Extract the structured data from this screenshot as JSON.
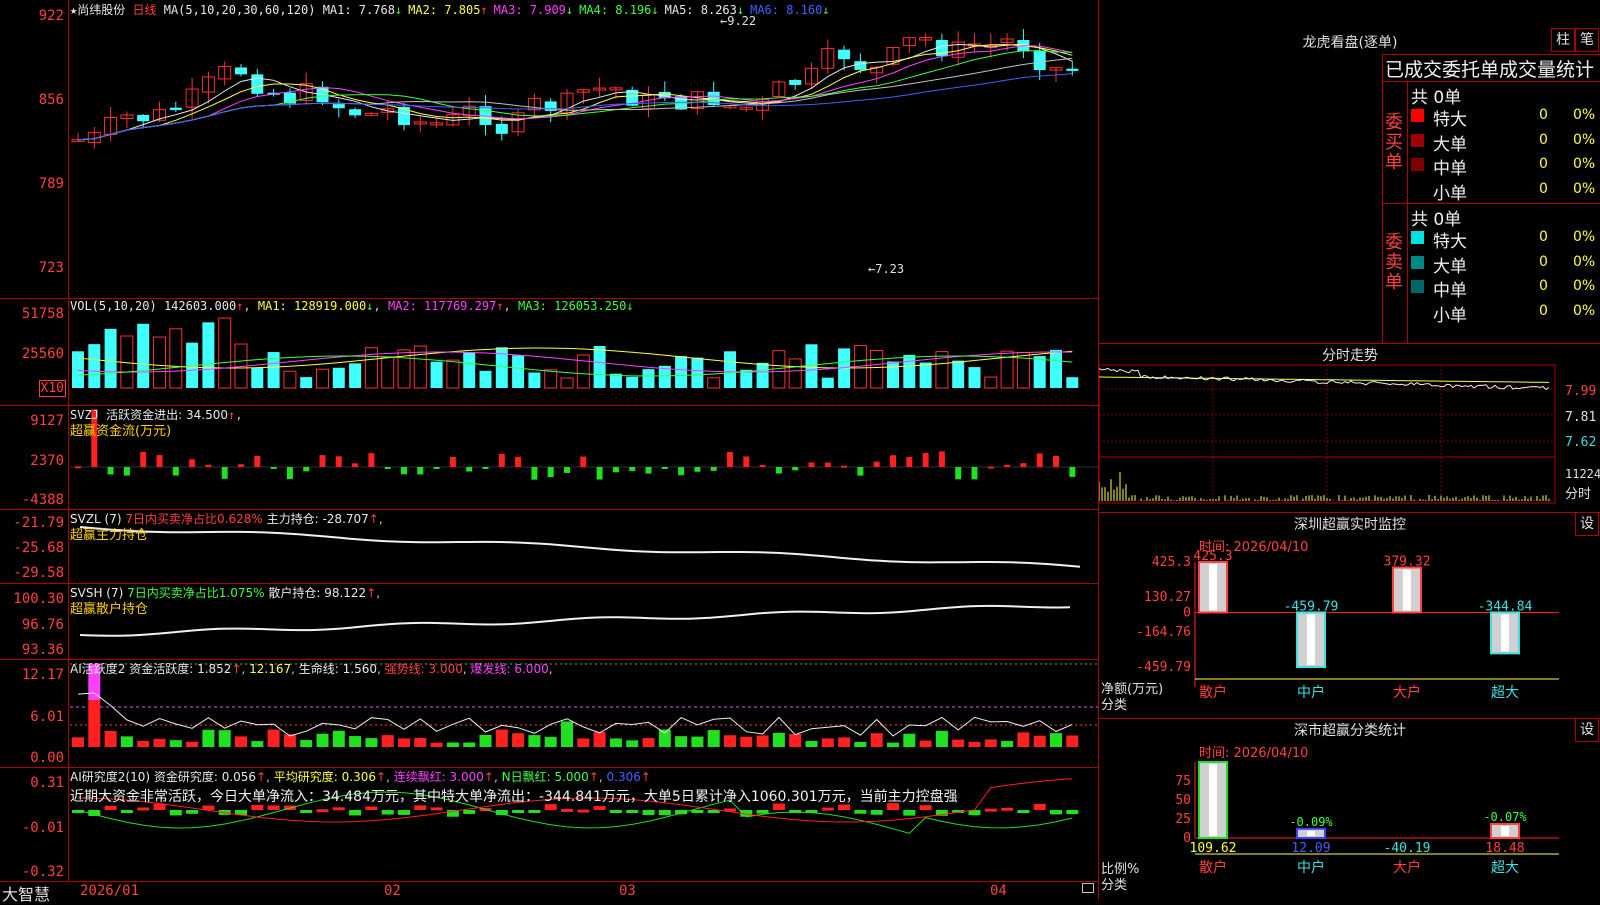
{
  "app_name": "大智慧",
  "stock": {
    "name": "尚纬股份",
    "period": "日线",
    "star": "★"
  },
  "price_panel": {
    "ma_label": "MA(5,10,20,30,60,120)",
    "ma_values": [
      {
        "label": "MA1:",
        "value": "7.768",
        "arrow": "↓",
        "color": "#e8e8e8"
      },
      {
        "label": "MA2:",
        "value": "7.805",
        "arrow": "↑",
        "color": "#ffff40"
      },
      {
        "label": "MA3:",
        "value": "7.909",
        "arrow": "↓",
        "color": "#ff40ff"
      },
      {
        "label": "MA4:",
        "value": "8.196",
        "arrow": "↓",
        "color": "#40ff40"
      },
      {
        "label": "MA5:",
        "value": "8.263",
        "arrow": "↓",
        "color": "#e8e8e8"
      },
      {
        "label": "MA6:",
        "value": "8.160",
        "arrow": "↓",
        "color": "#4060ff"
      }
    ],
    "y_ticks": [
      "922",
      "856",
      "789",
      "723"
    ],
    "high_label": "9.22",
    "low_label": "7.23"
  },
  "vol_panel": {
    "title": "VOL(5,10,20)",
    "value": "142603.000",
    "value_arrow": "↑",
    "ma1": "MA1: 128919.000",
    "ma1_arrow": "↓",
    "ma2": "MA2: 117769.297",
    "ma2_arrow": "↑",
    "ma3": "MA3: 126053.250",
    "ma3_arrow": "↓",
    "y_ticks": [
      "51758",
      "25560"
    ],
    "unit": "X10"
  },
  "svzj_panel": {
    "title": "SVZJ",
    "label": "活跃资金进出: 34.500",
    "arrow": "↑",
    "subtitle": "超赢资金流(万元)",
    "y_ticks": [
      "9127",
      "2370",
      "-4388"
    ]
  },
  "svzl_panel": {
    "title": "SVZL (7)",
    "ratio": "7日内买卖净占比0.628%",
    "hold": "主力持仓: -28.707",
    "arrow": "↑",
    "subtitle": "超赢主力持仓",
    "y_ticks": [
      "-21.79",
      "-25.68",
      "-29.58"
    ]
  },
  "svsh_panel": {
    "title": "SVSH (7)",
    "ratio": "7日内买卖净占比1.075%",
    "hold": "散户持仓: 98.122",
    "arrow": "↑",
    "subtitle": "超赢散户持仓",
    "y_ticks": [
      "100.30",
      "96.76",
      "93.36"
    ]
  },
  "ai_active_panel": {
    "title": "AI活跃度2",
    "active": "资金活跃度: 1.852",
    "v2": "12.167",
    "life": "生命线: 1.560",
    "strong": "强势线: 3.000",
    "burst": "爆发线: 6.000",
    "y_ticks": [
      "12.17",
      "6.01",
      "0.00"
    ]
  },
  "ai_research_panel": {
    "title": "AI研究度2(10)",
    "research": "资金研究度: 0.056",
    "avg": "平均研究度: 0.306",
    "red": "连续飘红: 3.000",
    "nred": "N日飘红: 5.000",
    "last": "0.306",
    "summary": "近期大资金非常活跃，今日大单净流入：34.484万元，其中特大单净流出：-344.841万元，大单5日累计净入1060.301万元，当前主力控盘强",
    "y_ticks": [
      "0.31",
      "-0.01",
      "-0.32"
    ]
  },
  "x_axis": {
    "labels": [
      "2026/01",
      "02",
      "03",
      "04"
    ]
  },
  "dragon": {
    "title": "龙虎看盘(逐单)",
    "btn1": "柱",
    "btn2": "笔",
    "header": "已成交委托单成交量统计",
    "buy_side": "委买单",
    "sell_side": "委卖单",
    "buy_total": "共 0单",
    "sell_total": "共 0单",
    "buy_rows": [
      {
        "label": "特大",
        "count": "0",
        "pct": "0%",
        "color": "#ff0000"
      },
      {
        "label": "大单",
        "count": "0",
        "pct": "0%",
        "color": "#a00000"
      },
      {
        "label": "中单",
        "count": "0",
        "pct": "0%",
        "color": "#800000"
      },
      {
        "label": "小单",
        "count": "0",
        "pct": "0%",
        "color": "#000000"
      }
    ],
    "sell_rows": [
      {
        "label": "特大",
        "count": "0",
        "pct": "0%",
        "color": "#00e0e0"
      },
      {
        "label": "大单",
        "count": "0",
        "pct": "0%",
        "color": "#008888"
      },
      {
        "label": "中单",
        "count": "0",
        "pct": "0%",
        "color": "#006666"
      },
      {
        "label": "小单",
        "count": "0",
        "pct": "0%",
        "color": "#000000"
      }
    ]
  },
  "intraday": {
    "title": "分时走势",
    "y_ticks": [
      "7.99",
      "7.81",
      "7.62"
    ],
    "vol_tick": "11224",
    "vol_label": "分时"
  },
  "sz_monitor": {
    "title": "深圳超赢实时监控",
    "btn": "设",
    "time": "时间: 2026/04/10",
    "y_ticks": [
      "425.3",
      "130.27",
      "0",
      "-164.76",
      "-459.79"
    ],
    "y_label": "净额(万元)",
    "x_label": "分类",
    "chart_data": {
      "type": "bar",
      "categories": [
        "散户",
        "中户",
        "大户",
        "超大"
      ],
      "values": [
        425.3,
        -459.79,
        379.32,
        -344.84
      ],
      "ylim": [
        -459.79,
        425.3
      ]
    },
    "value_labels": [
      "425.3",
      "-459.79",
      "379.32",
      "-344.84"
    ]
  },
  "sz_class": {
    "title": "深市超赢分类统计",
    "btn": "设",
    "time": "时间: 2026/04/10",
    "y_ticks": [
      "75",
      "50",
      "25",
      "0"
    ],
    "y_label": "比例%",
    "x_label": "分类",
    "chart_data": {
      "type": "bar",
      "categories": [
        "散户",
        "中户",
        "大户",
        "超大"
      ],
      "values": [
        109.62,
        12.09,
        -40.19,
        18.48
      ],
      "ylim": [
        0,
        100
      ]
    },
    "top_labels": [
      "",
      "-0.09%",
      "",
      "-0.07%"
    ],
    "value_labels": [
      "109.62",
      "12.09",
      "-40.19",
      "18.48"
    ]
  }
}
